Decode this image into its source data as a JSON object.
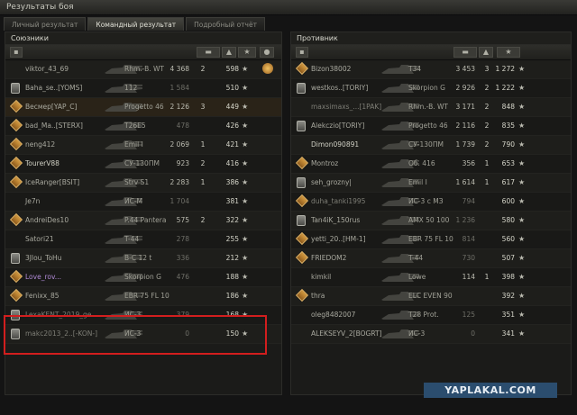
{
  "window": {
    "title": "Результаты боя"
  },
  "tabs": [
    {
      "label": "Личный результат",
      "active": false
    },
    {
      "label": "Командный результат",
      "active": true
    },
    {
      "label": "Подробный отчёт",
      "active": false
    }
  ],
  "allies": {
    "title": "Союзники",
    "rows": [
      {
        "name": "viktor_43_69",
        "tank": "Rhm.-B. WT",
        "damage": "4 368",
        "kills": "2",
        "xp": "598",
        "style": "normal",
        "badge": "",
        "award": true
      },
      {
        "name": "Baha_se..[YOMS]",
        "tank": "112",
        "damage": "1 584",
        "kills": "",
        "xp": "510",
        "style": "normal",
        "badge": "class",
        "award": false
      },
      {
        "name": "Весмер[YAP_C]",
        "tank": "Progetto 46",
        "damage": "2 126",
        "kills": "3",
        "xp": "449",
        "style": "me",
        "badge": "medal",
        "award": false
      },
      {
        "name": "bad_Ma..[STERX]",
        "tank": "T26E5",
        "damage": "478",
        "kills": "",
        "xp": "426",
        "style": "normal",
        "badge": "medal",
        "award": false
      },
      {
        "name": "neng412",
        "tank": "Emil I",
        "damage": "2 069",
        "kills": "1",
        "xp": "421",
        "style": "normal",
        "badge": "medal",
        "award": false
      },
      {
        "name": "TourerV88",
        "tank": "СУ-130ПМ",
        "damage": "923",
        "kills": "2",
        "xp": "416",
        "style": "bright",
        "badge": "medal",
        "award": false
      },
      {
        "name": "IceRanger[BSIT]",
        "tank": "Strv S1",
        "damage": "2 283",
        "kills": "1",
        "xp": "386",
        "style": "normal",
        "badge": "medal",
        "award": false
      },
      {
        "name": "Je7n",
        "tank": "ИС-М",
        "damage": "1 704",
        "kills": "",
        "xp": "381",
        "style": "normal",
        "badge": "",
        "award": false
      },
      {
        "name": "AndreiDes10",
        "tank": "P.44 Pantera",
        "damage": "575",
        "kills": "2",
        "xp": "322",
        "style": "normal",
        "badge": "medal",
        "award": false
      },
      {
        "name": "Satori21",
        "tank": "T-44",
        "damage": "278",
        "kills": "",
        "xp": "255",
        "style": "normal",
        "badge": "",
        "award": false
      },
      {
        "name": "3Jlou_ToHu",
        "tank": "B-C 12 t",
        "damage": "336",
        "kills": "",
        "xp": "212",
        "style": "normal",
        "badge": "class",
        "award": false
      },
      {
        "name": "Love_rov...",
        "tank": "Skorpion G",
        "damage": "476",
        "kills": "",
        "xp": "188",
        "style": "purple",
        "badge": "medal",
        "award": false
      },
      {
        "name": "Fenixx_85",
        "tank": "EBR 75 FL 10",
        "damage": "",
        "kills": "",
        "xp": "186",
        "style": "normal",
        "badge": "medal",
        "award": false
      },
      {
        "name": "LexaKENT_2019_ge...",
        "tank": "ИС-3",
        "damage": "379",
        "kills": "",
        "xp": "168",
        "style": "dim",
        "badge": "class",
        "award": false
      },
      {
        "name": "makc2013_2..[-KON-]",
        "tank": "ИС-3",
        "damage": "0",
        "kills": "",
        "xp": "150",
        "style": "dim",
        "badge": "class",
        "award": false
      }
    ]
  },
  "enemies": {
    "title": "Противник",
    "rows": [
      {
        "name": "Bizon38002",
        "tank": "T34",
        "damage": "3 453",
        "kills": "3",
        "xp": "1 272",
        "style": "normal",
        "badge": "medal"
      },
      {
        "name": "westkos..[TORIY]",
        "tank": "Skorpion G",
        "damage": "2 926",
        "kills": "2",
        "xp": "1 222",
        "style": "normal",
        "badge": "class"
      },
      {
        "name": "maxsimaxs_...[1PAK]",
        "tank": "Rhm.-B. WT",
        "damage": "3 171",
        "kills": "2",
        "xp": "848",
        "style": "dim",
        "badge": ""
      },
      {
        "name": "Alekczio[TORIY]",
        "tank": "Progetto 46",
        "damage": "2 116",
        "kills": "2",
        "xp": "835",
        "style": "normal",
        "badge": "class"
      },
      {
        "name": "Dimon090891",
        "tank": "СУ-130ПМ",
        "damage": "1 739",
        "kills": "2",
        "xp": "790",
        "style": "bright",
        "badge": ""
      },
      {
        "name": "Montroz",
        "tank": "Об. 416",
        "damage": "356",
        "kills": "1",
        "xp": "653",
        "style": "normal",
        "badge": "medal"
      },
      {
        "name": "seh_grozny|",
        "tank": "Emil I",
        "damage": "1 614",
        "kills": "1",
        "xp": "617",
        "style": "normal",
        "badge": "class"
      },
      {
        "name": "duha_tanki1995",
        "tank": "ИС-3 с МЗ",
        "damage": "794",
        "kills": "",
        "xp": "600",
        "style": "dim",
        "badge": "medal"
      },
      {
        "name": "Tan4iK_150rus",
        "tank": "AMX 50 100",
        "damage": "1 236",
        "kills": "",
        "xp": "580",
        "style": "normal",
        "badge": "class"
      },
      {
        "name": "yetti_20..[HM-1]",
        "tank": "EBR 75 FL 10",
        "damage": "814",
        "kills": "",
        "xp": "560",
        "style": "normal",
        "badge": "medal"
      },
      {
        "name": "FRIEDOM2",
        "tank": "T-44",
        "damage": "730",
        "kills": "",
        "xp": "507",
        "style": "normal",
        "badge": "medal"
      },
      {
        "name": "kimkil",
        "tank": "Lowe",
        "damage": "114",
        "kills": "1",
        "xp": "398",
        "style": "normal",
        "badge": ""
      },
      {
        "name": "thra",
        "tank": "ELC EVEN 90",
        "damage": "",
        "kills": "",
        "xp": "392",
        "style": "normal",
        "badge": "medal"
      },
      {
        "name": "oleg8482007",
        "tank": "T28 Prot.",
        "damage": "125",
        "kills": "",
        "xp": "351",
        "style": "normal",
        "badge": ""
      },
      {
        "name": "ALEKSEYV_2[BOGRT]",
        "tank": "ИС-3",
        "damage": "0",
        "kills": "",
        "xp": "341",
        "style": "normal",
        "badge": ""
      }
    ]
  },
  "watermark": "YAPLAKAL.COM",
  "icons": {
    "star": "★",
    "highlight_color": "#d21e1e"
  }
}
